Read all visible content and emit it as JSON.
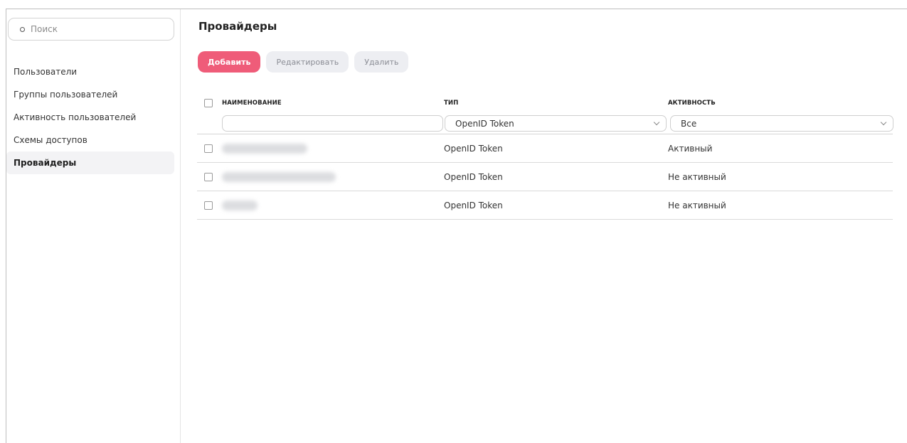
{
  "sidebar": {
    "search": {
      "placeholder": "Поиск",
      "value": ""
    },
    "items": [
      {
        "label": "Пользователи",
        "active": false
      },
      {
        "label": "Группы пользователей",
        "active": false
      },
      {
        "label": "Активность пользователей",
        "active": false
      },
      {
        "label": "Схемы доступов",
        "active": false
      },
      {
        "label": "Провайдеры",
        "active": true
      }
    ]
  },
  "main": {
    "title": "Провайдеры",
    "toolbar": {
      "add_label": "Добавить",
      "edit_label": "Редактировать",
      "delete_label": "Удалить"
    },
    "table": {
      "columns": {
        "name": "НАИМЕНОВАНИЕ",
        "type": "ТИП",
        "activity": "АКТИВНОСТЬ"
      },
      "filters": {
        "name_value": "",
        "type_value": "OpenID Token",
        "activity_value": "Все"
      },
      "rows": [
        {
          "type": "OpenID Token",
          "activity": "Активный"
        },
        {
          "type": "OpenID Token",
          "activity": "Не активный"
        },
        {
          "type": "OpenID Token",
          "activity": "Не активный"
        }
      ]
    }
  },
  "colors": {
    "accent": "#ef5c79",
    "secondary_button_bg": "#edeef2",
    "active_nav_bg": "#f3f3f5"
  },
  "icons": [
    "search-icon",
    "chevron-down-icon"
  ]
}
